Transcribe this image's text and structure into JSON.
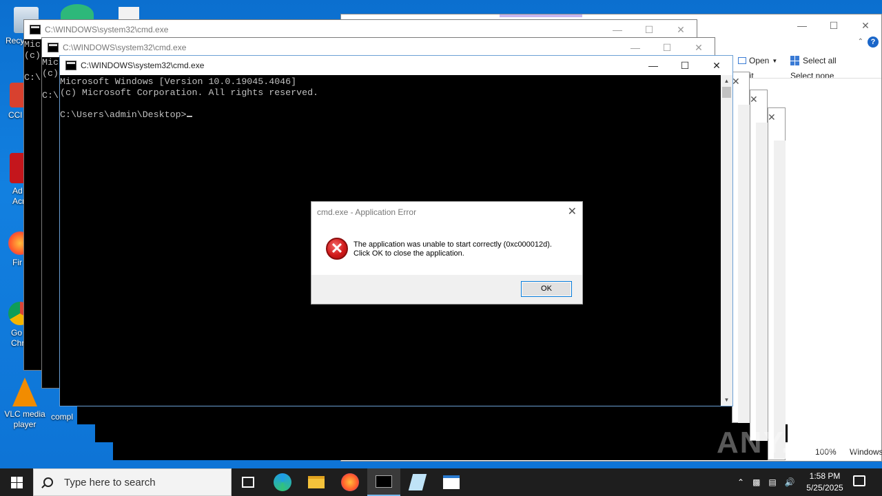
{
  "desktop": {
    "icons": [
      {
        "name": "recycle-bin",
        "label": "Recy"
      },
      {
        "name": "ccleaner",
        "label": "CCl"
      },
      {
        "name": "adobe-acrobat",
        "label": "Ad\nAcr"
      },
      {
        "name": "firefox",
        "label": "Fir"
      },
      {
        "name": "google-chrome",
        "label": "Go\nChr"
      },
      {
        "name": "vlc",
        "label": "VLC media\nplayer"
      },
      {
        "name": "compl",
        "label": "compl"
      }
    ]
  },
  "explorer": {
    "open_label": "Open",
    "edit_label": "Edit",
    "select_all_label": "Select all",
    "select_none_label": "Select none",
    "zoom": "100%",
    "status_right": "Windows"
  },
  "cmd_windows": [
    {
      "title": "C:\\WINDOWS\\system32\\cmd.exe",
      "lines": [
        "Mic",
        "(c)",
        "",
        "C:\\"
      ]
    },
    {
      "title": "C:\\WINDOWS\\system32\\cmd.exe",
      "lines": [
        "Mic",
        "(c)",
        "",
        "C:\\"
      ]
    },
    {
      "title": "C:\\WINDOWS\\system32\\cmd.exe",
      "line1": "Microsoft Windows [Version 10.0.19045.4046]",
      "line2": "(c) Microsoft Corporation. All rights reserved.",
      "prompt": "C:\\Users\\admin\\Desktop>"
    }
  ],
  "dialog": {
    "title": "cmd.exe - Application Error",
    "message_line1": "The application was unable to start correctly (0xc000012d).",
    "message_line2": "Click OK to close the application.",
    "ok_label": "OK"
  },
  "taskbar": {
    "search_placeholder": "Type here to search",
    "time": "1:58 PM",
    "date": "5/25/2025"
  },
  "watermark": "ANY.RUN"
}
